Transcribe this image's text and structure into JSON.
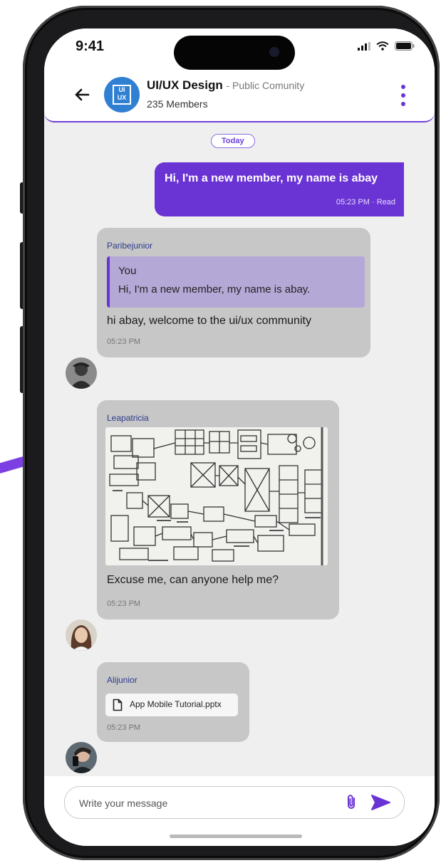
{
  "status_bar": {
    "time": "9:41"
  },
  "header": {
    "group_name": "UI/UX Design",
    "group_type": "- Public Comunity",
    "members": "235 Members",
    "avatar_text": "UI UX"
  },
  "date_divider": "Today",
  "messages": [
    {
      "type": "outgoing",
      "text": "Hi, I'm a new member, my name is abay",
      "meta": "05:23 PM · Read"
    },
    {
      "type": "incoming",
      "sender": "Paribejunior",
      "quote_author": "You",
      "quote_text": "Hi, I'm a new member, my name is abay.",
      "text": "hi abay, welcome to the ui/ux community",
      "time": "05:23 PM"
    },
    {
      "type": "incoming-image",
      "sender": "Leapatricia",
      "text": "Excuse me, can anyone help me?",
      "time": "05:23 PM"
    },
    {
      "type": "incoming-file",
      "sender": "Alijunior",
      "file_name": "App Mobile Tutorial.pptx",
      "time": "05:23 PM"
    }
  ],
  "composer": {
    "placeholder": "Write your message"
  },
  "colors": {
    "accent": "#6a33d4",
    "incoming_bubble": "#c7c7c7",
    "background": "#efefef",
    "sender_name": "#2d3a8c"
  },
  "icons": [
    "back-arrow-icon",
    "more-vertical-icon",
    "signal-icon",
    "wifi-icon",
    "battery-icon",
    "file-icon",
    "paperclip-icon",
    "send-icon"
  ]
}
